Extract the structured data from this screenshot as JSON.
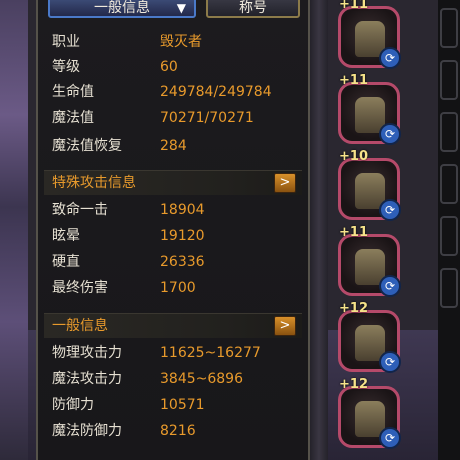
{
  "tabs": {
    "general": "一般信息",
    "title": "称号"
  },
  "basic_stats": [
    {
      "label": "职业",
      "value": "毁灭者"
    },
    {
      "label": "等级",
      "value": "60"
    },
    {
      "label": "生命值",
      "value": "249784/249784"
    },
    {
      "label": "魔法值",
      "value": "70271/70271"
    },
    {
      "label": "魔法值恢复",
      "value": "284"
    }
  ],
  "special_attack": {
    "title": "特殊攻击信息",
    "stats": [
      {
        "label": "致命一击",
        "value": "18904"
      },
      {
        "label": "眩晕",
        "value": "19120"
      },
      {
        "label": "硬直",
        "value": "26336"
      },
      {
        "label": "最终伤害",
        "value": "1700"
      }
    ]
  },
  "general_info": {
    "title": "一般信息",
    "stats": [
      {
        "label": "物理攻击力",
        "value": "11625~16277"
      },
      {
        "label": "魔法攻击力",
        "value": "3845~6896"
      },
      {
        "label": "防御力",
        "value": "10571"
      },
      {
        "label": "魔法防御力",
        "value": "8216"
      }
    ]
  },
  "equipment": [
    {
      "enhance": "+11"
    },
    {
      "enhance": "+11"
    },
    {
      "enhance": "+10"
    },
    {
      "enhance": "+11"
    },
    {
      "enhance": "+12"
    },
    {
      "enhance": "+12"
    }
  ]
}
